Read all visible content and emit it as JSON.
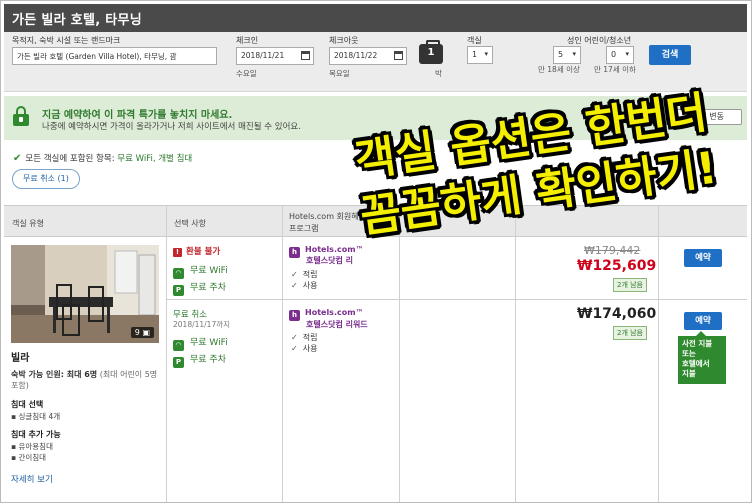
{
  "header": {
    "title": "가든 빌라 호텔, 타무닝"
  },
  "search": {
    "destination_label": "목적지, 숙박 시설 또는 랜드마크",
    "destination_value": "가든 빌라 호텔 (Garden Villa Hotel), 타무닝, 괌",
    "checkin_label": "체크인",
    "checkin_value": "2018/11/21",
    "checkin_day": "수요일",
    "checkout_label": "체크아웃",
    "checkout_value": "2018/11/22",
    "checkout_day": "목요일",
    "nights_value": "1",
    "nights_label": "박",
    "rooms_label": "객실",
    "rooms_value": "1",
    "guests_label": "성인 어린이/청소년",
    "adults_value": "5",
    "adults_sub": "만 18세 이상",
    "children_value": "0",
    "children_sub": "만 17세 이하",
    "search_button": "검색"
  },
  "promo": {
    "title": "지금 예약하여 이 파격 특가를 놓치지 마세요.",
    "text": "나중에 예약하시면 가격이 올라가거나 저희 사이트에서 매진될 수 있어요.",
    "button": "가격 변동"
  },
  "included": {
    "label": "모든 객실에 포함된 항목:",
    "items": "무료 WiFi, 개별 침대",
    "filter_pill": "무료 취소 (1)"
  },
  "table": {
    "col_room": "객실 유형",
    "col_options": "선택 사항",
    "col_rewards_1": "Hotels.com 회원혜",
    "col_rewards_2": "프로그램"
  },
  "room": {
    "photo_count": "9",
    "name": "빌라",
    "occupancy_bold": "숙박 가능 인원: 최대 6명",
    "occupancy_note": "(최대 어린이 5명 포함)",
    "bed_choice_title": "침대 선택",
    "bed_choice_item": "싱글침대 4개",
    "extra_bed_title": "침대 추가 가능",
    "extra_bed_items": [
      "유아용침대",
      "간이침대"
    ],
    "more_link": "자세히 보기"
  },
  "rates": [
    {
      "policy": "환불 불가",
      "wifi": "무료 WiFi",
      "parking": "무료 주차",
      "hc_title": "Hotels.com™",
      "hc_sub": "호텔스닷컴 리",
      "earn": "적립",
      "use": "사용",
      "old_price": "₩179,442",
      "price": "₩125,609",
      "left": "2개 남음",
      "reserve": "예약"
    },
    {
      "policy": "무료 취소",
      "policy_date": "2018/11/17까지",
      "wifi": "무료 WiFi",
      "parking": "무료 주차",
      "hc_title": "Hotels.com™",
      "hc_sub": "호텔스닷컴 리워드",
      "earn": "적립",
      "use": "사용",
      "price": "₩174,060",
      "left": "2개 남음",
      "reserve": "예약",
      "pay_note_1": "사전 지불",
      "pay_note_2": "또는",
      "pay_note_3": "호텔에서",
      "pay_note_4": "지불"
    }
  ],
  "overlay": {
    "line1": "객실 옵션은 한번더",
    "line2": "꼼꼼하게 확인하기!"
  },
  "colors": {
    "accent_blue": "#1f6fc5",
    "price_red": "#d0021b",
    "green": "#2f8a2f",
    "overlay_yellow": "#f4ee00"
  }
}
